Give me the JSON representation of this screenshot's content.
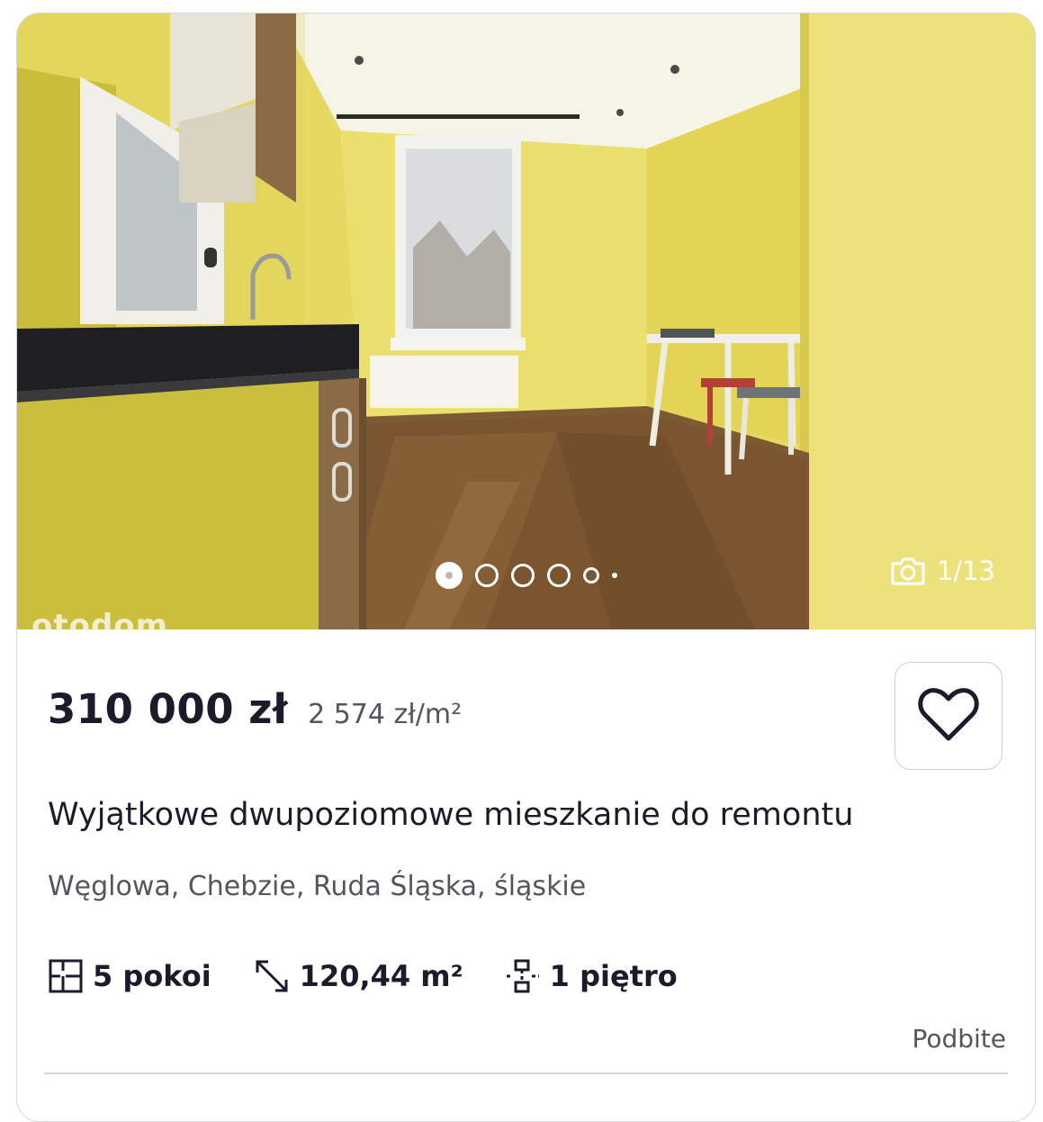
{
  "listing": {
    "price": "310 000 zł",
    "price_per_m2": "2 574 zł/m²",
    "title": "Wyjątkowe dwupoziomowe mieszkanie do remontu",
    "location": "Węglowa, Chebzie, Ruda Śląska, śląskie",
    "features": {
      "rooms": "5 pokoi",
      "area": "120,44 m²",
      "floor": "1 piętro"
    },
    "bumped_label": "Podbite"
  },
  "gallery": {
    "counter": "1/13",
    "watermark": "otodom",
    "current_index": 1,
    "total": 13
  },
  "colors": {
    "text_primary": "#1b1b2b",
    "text_secondary": "#55555f",
    "border": "#d8d8dc"
  },
  "icons": {
    "favorite": "heart-icon",
    "gallery": "camera-icon",
    "rooms": "rooms-icon",
    "area": "area-arrows-icon",
    "floor": "floor-icon"
  }
}
